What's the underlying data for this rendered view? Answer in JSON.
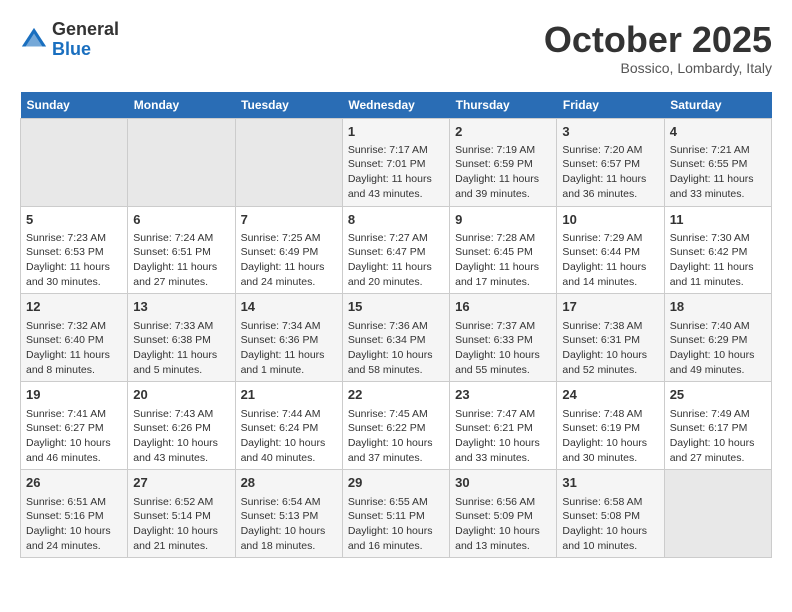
{
  "logo": {
    "general": "General",
    "blue": "Blue"
  },
  "title": "October 2025",
  "location": "Bossico, Lombardy, Italy",
  "days_of_week": [
    "Sunday",
    "Monday",
    "Tuesday",
    "Wednesday",
    "Thursday",
    "Friday",
    "Saturday"
  ],
  "weeks": [
    [
      {
        "day": "",
        "info": ""
      },
      {
        "day": "",
        "info": ""
      },
      {
        "day": "",
        "info": ""
      },
      {
        "day": "1",
        "info": "Sunrise: 7:17 AM\nSunset: 7:01 PM\nDaylight: 11 hours and 43 minutes."
      },
      {
        "day": "2",
        "info": "Sunrise: 7:19 AM\nSunset: 6:59 PM\nDaylight: 11 hours and 39 minutes."
      },
      {
        "day": "3",
        "info": "Sunrise: 7:20 AM\nSunset: 6:57 PM\nDaylight: 11 hours and 36 minutes."
      },
      {
        "day": "4",
        "info": "Sunrise: 7:21 AM\nSunset: 6:55 PM\nDaylight: 11 hours and 33 minutes."
      }
    ],
    [
      {
        "day": "5",
        "info": "Sunrise: 7:23 AM\nSunset: 6:53 PM\nDaylight: 11 hours and 30 minutes."
      },
      {
        "day": "6",
        "info": "Sunrise: 7:24 AM\nSunset: 6:51 PM\nDaylight: 11 hours and 27 minutes."
      },
      {
        "day": "7",
        "info": "Sunrise: 7:25 AM\nSunset: 6:49 PM\nDaylight: 11 hours and 24 minutes."
      },
      {
        "day": "8",
        "info": "Sunrise: 7:27 AM\nSunset: 6:47 PM\nDaylight: 11 hours and 20 minutes."
      },
      {
        "day": "9",
        "info": "Sunrise: 7:28 AM\nSunset: 6:45 PM\nDaylight: 11 hours and 17 minutes."
      },
      {
        "day": "10",
        "info": "Sunrise: 7:29 AM\nSunset: 6:44 PM\nDaylight: 11 hours and 14 minutes."
      },
      {
        "day": "11",
        "info": "Sunrise: 7:30 AM\nSunset: 6:42 PM\nDaylight: 11 hours and 11 minutes."
      }
    ],
    [
      {
        "day": "12",
        "info": "Sunrise: 7:32 AM\nSunset: 6:40 PM\nDaylight: 11 hours and 8 minutes."
      },
      {
        "day": "13",
        "info": "Sunrise: 7:33 AM\nSunset: 6:38 PM\nDaylight: 11 hours and 5 minutes."
      },
      {
        "day": "14",
        "info": "Sunrise: 7:34 AM\nSunset: 6:36 PM\nDaylight: 11 hours and 1 minute."
      },
      {
        "day": "15",
        "info": "Sunrise: 7:36 AM\nSunset: 6:34 PM\nDaylight: 10 hours and 58 minutes."
      },
      {
        "day": "16",
        "info": "Sunrise: 7:37 AM\nSunset: 6:33 PM\nDaylight: 10 hours and 55 minutes."
      },
      {
        "day": "17",
        "info": "Sunrise: 7:38 AM\nSunset: 6:31 PM\nDaylight: 10 hours and 52 minutes."
      },
      {
        "day": "18",
        "info": "Sunrise: 7:40 AM\nSunset: 6:29 PM\nDaylight: 10 hours and 49 minutes."
      }
    ],
    [
      {
        "day": "19",
        "info": "Sunrise: 7:41 AM\nSunset: 6:27 PM\nDaylight: 10 hours and 46 minutes."
      },
      {
        "day": "20",
        "info": "Sunrise: 7:43 AM\nSunset: 6:26 PM\nDaylight: 10 hours and 43 minutes."
      },
      {
        "day": "21",
        "info": "Sunrise: 7:44 AM\nSunset: 6:24 PM\nDaylight: 10 hours and 40 minutes."
      },
      {
        "day": "22",
        "info": "Sunrise: 7:45 AM\nSunset: 6:22 PM\nDaylight: 10 hours and 37 minutes."
      },
      {
        "day": "23",
        "info": "Sunrise: 7:47 AM\nSunset: 6:21 PM\nDaylight: 10 hours and 33 minutes."
      },
      {
        "day": "24",
        "info": "Sunrise: 7:48 AM\nSunset: 6:19 PM\nDaylight: 10 hours and 30 minutes."
      },
      {
        "day": "25",
        "info": "Sunrise: 7:49 AM\nSunset: 6:17 PM\nDaylight: 10 hours and 27 minutes."
      }
    ],
    [
      {
        "day": "26",
        "info": "Sunrise: 6:51 AM\nSunset: 5:16 PM\nDaylight: 10 hours and 24 minutes."
      },
      {
        "day": "27",
        "info": "Sunrise: 6:52 AM\nSunset: 5:14 PM\nDaylight: 10 hours and 21 minutes."
      },
      {
        "day": "28",
        "info": "Sunrise: 6:54 AM\nSunset: 5:13 PM\nDaylight: 10 hours and 18 minutes."
      },
      {
        "day": "29",
        "info": "Sunrise: 6:55 AM\nSunset: 5:11 PM\nDaylight: 10 hours and 16 minutes."
      },
      {
        "day": "30",
        "info": "Sunrise: 6:56 AM\nSunset: 5:09 PM\nDaylight: 10 hours and 13 minutes."
      },
      {
        "day": "31",
        "info": "Sunrise: 6:58 AM\nSunset: 5:08 PM\nDaylight: 10 hours and 10 minutes."
      },
      {
        "day": "",
        "info": ""
      }
    ]
  ]
}
